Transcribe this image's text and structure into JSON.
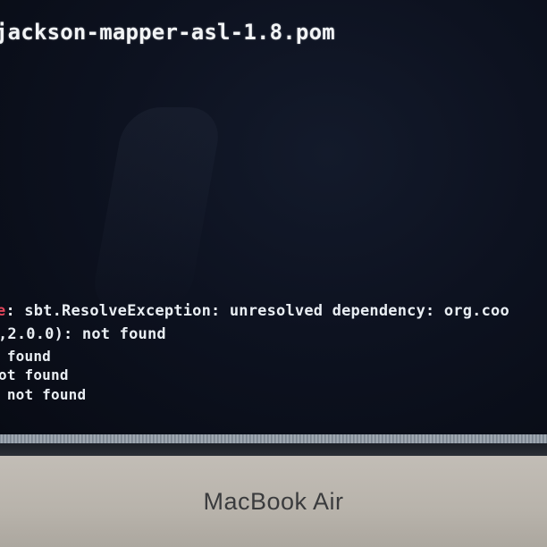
{
  "terminal": {
    "top_line": "jackson-mapper-asl-1.8.pom",
    "lines": [
      {
        "prefix": "e",
        "text": ": sbt.ResolveException: unresolved dependency: org.coo"
      },
      {
        "text": ",2.0.0): not found"
      },
      {
        "text": " found"
      },
      {
        "text": "ot found"
      },
      {
        "text": " not found"
      }
    ]
  },
  "device": {
    "brand_label": "MacBook Air"
  },
  "colors": {
    "screen_bg": "#0b0f1a",
    "text": "#e9eef3",
    "error_red": "#e0455a",
    "chin_silver": "#bdb8b1"
  }
}
